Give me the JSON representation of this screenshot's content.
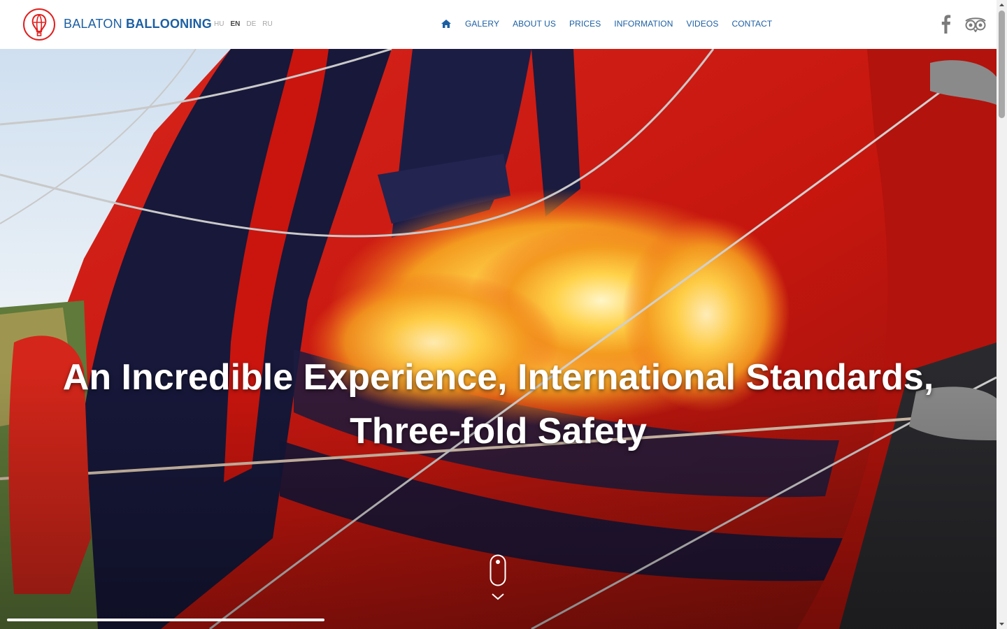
{
  "header": {
    "brand_light": "BALATON",
    "brand_bold": "BALLOONING",
    "languages": [
      "HU",
      "EN",
      "DE",
      "RU"
    ],
    "active_language": "EN",
    "nav": [
      "GALERY",
      "ABOUT US",
      "PRICES",
      "INFORMATION",
      "VIDEOS",
      "CONTACT"
    ],
    "icons": {
      "home": "home-icon",
      "logo": "balloon-logo",
      "facebook": "facebook-icon",
      "tripadvisor": "tripadvisor-icon"
    }
  },
  "hero": {
    "headline_line1": "An Incredible Experience, International Standards,",
    "headline_line2": "Three-fold Safety",
    "scroll_icon": "mouse-scroll-icon",
    "chevron_icon": "chevron-down-icon",
    "video_progress": 0.32
  },
  "colors": {
    "brand_blue": "#1b5fa3",
    "logo_red": "#e0201f",
    "social_gray": "#7a7a7a",
    "headline_white": "#ffffff"
  }
}
